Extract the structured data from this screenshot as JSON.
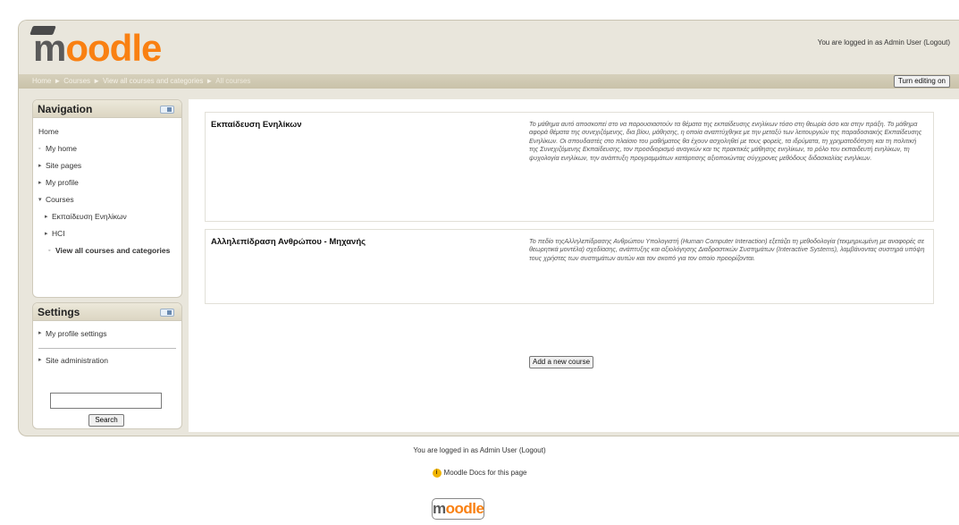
{
  "header": {
    "logo_prefix": "m",
    "logo_rest": "oodle",
    "login_text": "You are logged in as Admin User",
    "logout_link": "(Logout)"
  },
  "breadcrumb": {
    "items": [
      "Home",
      "Courses",
      "View all courses and categories"
    ],
    "current": "All courses",
    "separator": "►"
  },
  "turn_editing_label": "Turn editing on",
  "navigation": {
    "title": "Navigation",
    "home": "Home",
    "items": [
      {
        "label": "My home",
        "marker": "◦"
      },
      {
        "label": "Site pages",
        "marker": "▸"
      },
      {
        "label": "My profile",
        "marker": "▸"
      },
      {
        "label": "Courses",
        "marker": "▾"
      }
    ],
    "courses": [
      {
        "label": "Εκπαίδευση Ενηλίκων",
        "marker": "▸"
      },
      {
        "label": "HCI",
        "marker": "▸"
      }
    ],
    "view_all": {
      "label": "View all courses and categories",
      "marker": "◦"
    }
  },
  "settings": {
    "title": "Settings",
    "items": [
      {
        "label": "My profile settings",
        "marker": "▸"
      },
      {
        "label": "Site administration",
        "marker": "▸"
      }
    ],
    "search_button": "Search"
  },
  "courses": [
    {
      "name": "Εκπαίδευση Ενηλίκων",
      "summary": "Το μάθημα αυτό αποσκοπεί στο να παρουσιαστούν τα θέματα της εκπαίδευσης ενηλίκων τόσο στη θεωρία όσο και στην πράξη. Το μάθημα αφορά θέματα της συνεχιζόμενης, δια βίου, μάθησης, η οποία αναπτύχθηκε με την μεταξύ των λειτουργιών της παραδοσιακής Εκπαίδευσης Ενηλίκων. Οι σπουδαστές στο πλαίσιο του μαθήματος θα έχουν ασχοληθεί με τους φορείς, τα ιδρύματα, τη χρηματοδότηση και τη πολιτική της Συνεχιζόμενης Εκπαίδευσης, τον προσδιορισμό αναγκών και τις πρακτικές μάθησης ενηλίκων, το ρόλο του εκπαιδευτή ενηλίκων, τη ψυχολογία ενηλίκων, την ανάπτυξη προγραμμάτων κατάρτισης αξιοποιώντας σύγχρονες μεθόδους διδασκαλίας ενηλίκων."
    },
    {
      "name": "Αλληλεπίδραση Ανθρώπου - Μηχανής",
      "summary": "Το πεδίο τηςΑλληλεπίδρασης Ανθρώπου Υπολογιστή (Human Computer Interaction) εξετάζει τη μεθοδολογία (τεκμηριωμένη με αναφορές σε θεωρητικά μοντέλα) σχεδίασης, ανάπτυξης και αξιολόγησης Διαδραστικών Συστημάτων (Interactive Systems), λαμβάνοντας συστηρά υπόψη τους χρήστες των συστημάτων αυτών και τον σκοπό για τον οποίο προορίζονται."
    }
  ],
  "add_course_label": "Add a new course",
  "footer": {
    "login_text": "You are logged in as Admin User",
    "logout_link": "(Logout)",
    "docs_text": "Moodle Docs for this page",
    "docs_icon": "i",
    "logo_prefix": "m",
    "logo_rest": "oodle"
  },
  "colors": {
    "brand_orange": "#f98012",
    "brand_grey": "#5a5a5a",
    "header_bg": "#e9e6dc",
    "navbar_bg": "#cfc8b0"
  }
}
